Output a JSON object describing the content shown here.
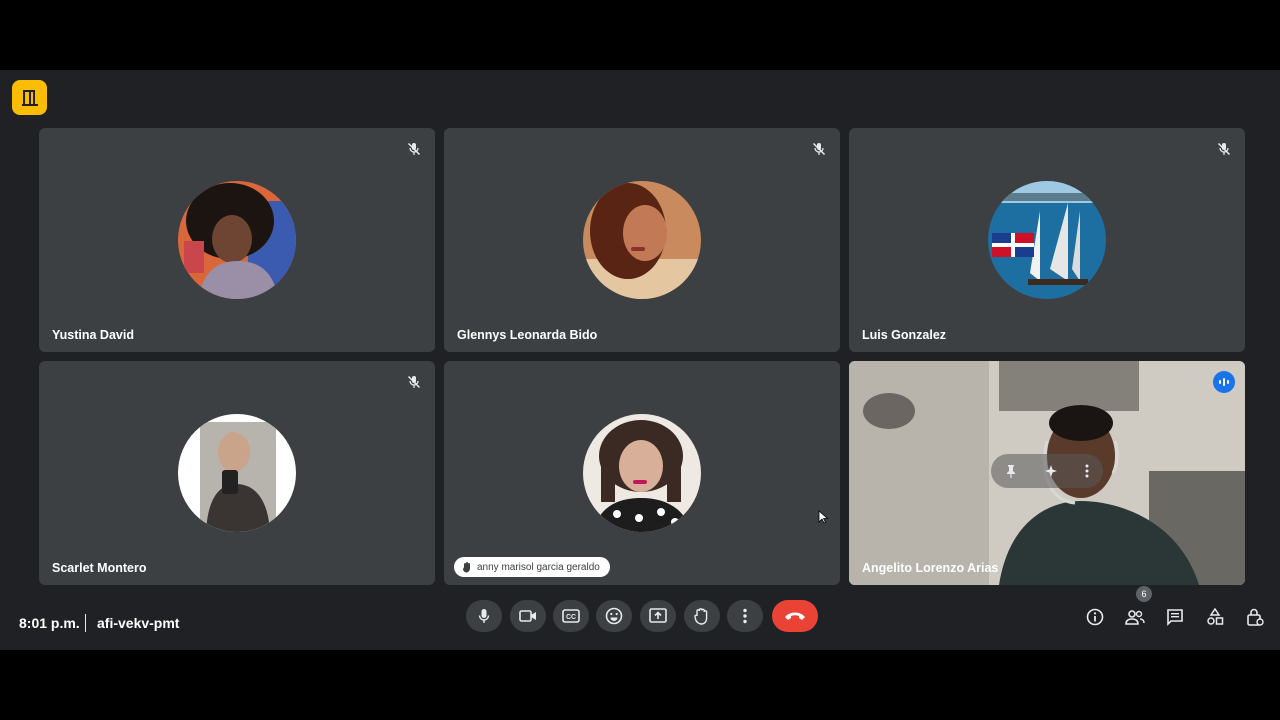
{
  "participants": [
    {
      "name": "Yustina David",
      "muted": true
    },
    {
      "name": "Glennys Leonarda Bido",
      "muted": true
    },
    {
      "name": "Luis Gonzalez",
      "muted": true
    },
    {
      "name": "Scarlet Montero",
      "muted": true
    },
    {
      "name": "anny marisol garcia geraldo",
      "hand_raised": true
    },
    {
      "name": "Angelito Lorenzo Arias",
      "speaking": true,
      "video_on": true
    }
  ],
  "footer": {
    "time": "8:01 p.m.",
    "separator": "|",
    "meeting_code": "afi-vekv-pmt"
  },
  "people_count": "6",
  "colors": {
    "background": "#202124",
    "tile": "#3c4043",
    "accent": "#8ab4f8",
    "end_call": "#ea4335",
    "logo": "#fbbc04"
  },
  "icons": [
    "door-icon",
    "mic-off-icon",
    "speaking-icon",
    "pin-icon",
    "hand-icon",
    "mic-icon",
    "camera-icon",
    "captions-icon",
    "emoji-icon",
    "present-icon",
    "raise-hand-icon",
    "more-vert-icon",
    "call-end-icon",
    "info-icon",
    "people-icon",
    "chat-icon",
    "activities-icon",
    "host-controls-icon"
  ]
}
